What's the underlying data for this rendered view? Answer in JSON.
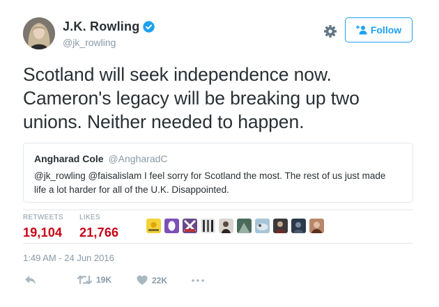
{
  "author": {
    "display_name": "J.K. Rowling",
    "handle": "@jk_rowling",
    "verified": true
  },
  "header": {
    "follow_label": "Follow"
  },
  "tweet": {
    "text_lines": [
      "Scotland will seek independence now.",
      "Cameron's legacy will be breaking up two",
      "unions. Neither needed to happen."
    ]
  },
  "quote": {
    "name": "Angharad Cole",
    "handle": "@AngharadC",
    "text_lines": [
      "@jk_rowling @faisalislam I feel sorry for Scotland  the most. The rest of us just made",
      "life a lot harder for all of the U.K. Disappointed."
    ]
  },
  "stats": {
    "retweets_label": "RETWEETS",
    "retweets_value": "19,104",
    "likes_label": "LIKES",
    "likes_value": "21,766"
  },
  "timestamp": "1:49 AM - 24 Jun 2016",
  "actions": {
    "retweet_count": "19K",
    "like_count": "22K"
  },
  "colors": {
    "accent": "#1da1f2",
    "stat_value": "#c70014",
    "muted": "#8899a6",
    "border": "#e1e8ed"
  }
}
